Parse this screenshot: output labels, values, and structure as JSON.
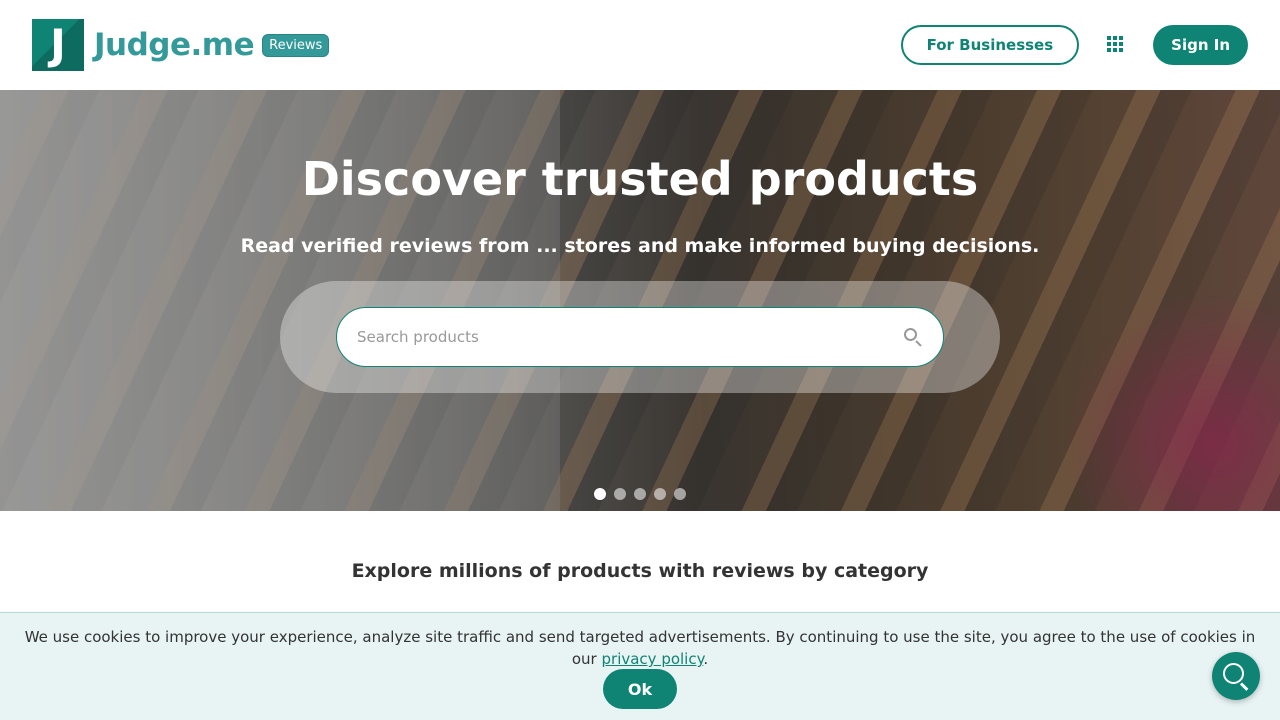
{
  "header": {
    "brand": "Judge.me",
    "badge": "Reviews",
    "logo_letter": "J",
    "for_businesses": "For Businesses",
    "sign_in": "Sign In",
    "apps_icon": "grid-icon"
  },
  "hero": {
    "title": "Discover trusted products",
    "subtitle": "Read verified reviews from ... stores and make informed buying decisions.",
    "search_placeholder": "Search products",
    "search_value": "",
    "carousel_slides": 5,
    "carousel_active": 1
  },
  "explore": {
    "heading": "Explore millions of products with reviews by category"
  },
  "cookie": {
    "text": "We use cookies to improve your experience, analyze site traffic and send targeted advertisements. By continuing to use the site, you agree to the use of cookies in our ",
    "link": "privacy policy",
    "after": ".",
    "ok": "Ok"
  },
  "colors": {
    "accent": "#108474",
    "brand_text": "#339999",
    "cookie_bg": "#e8f3f4"
  }
}
